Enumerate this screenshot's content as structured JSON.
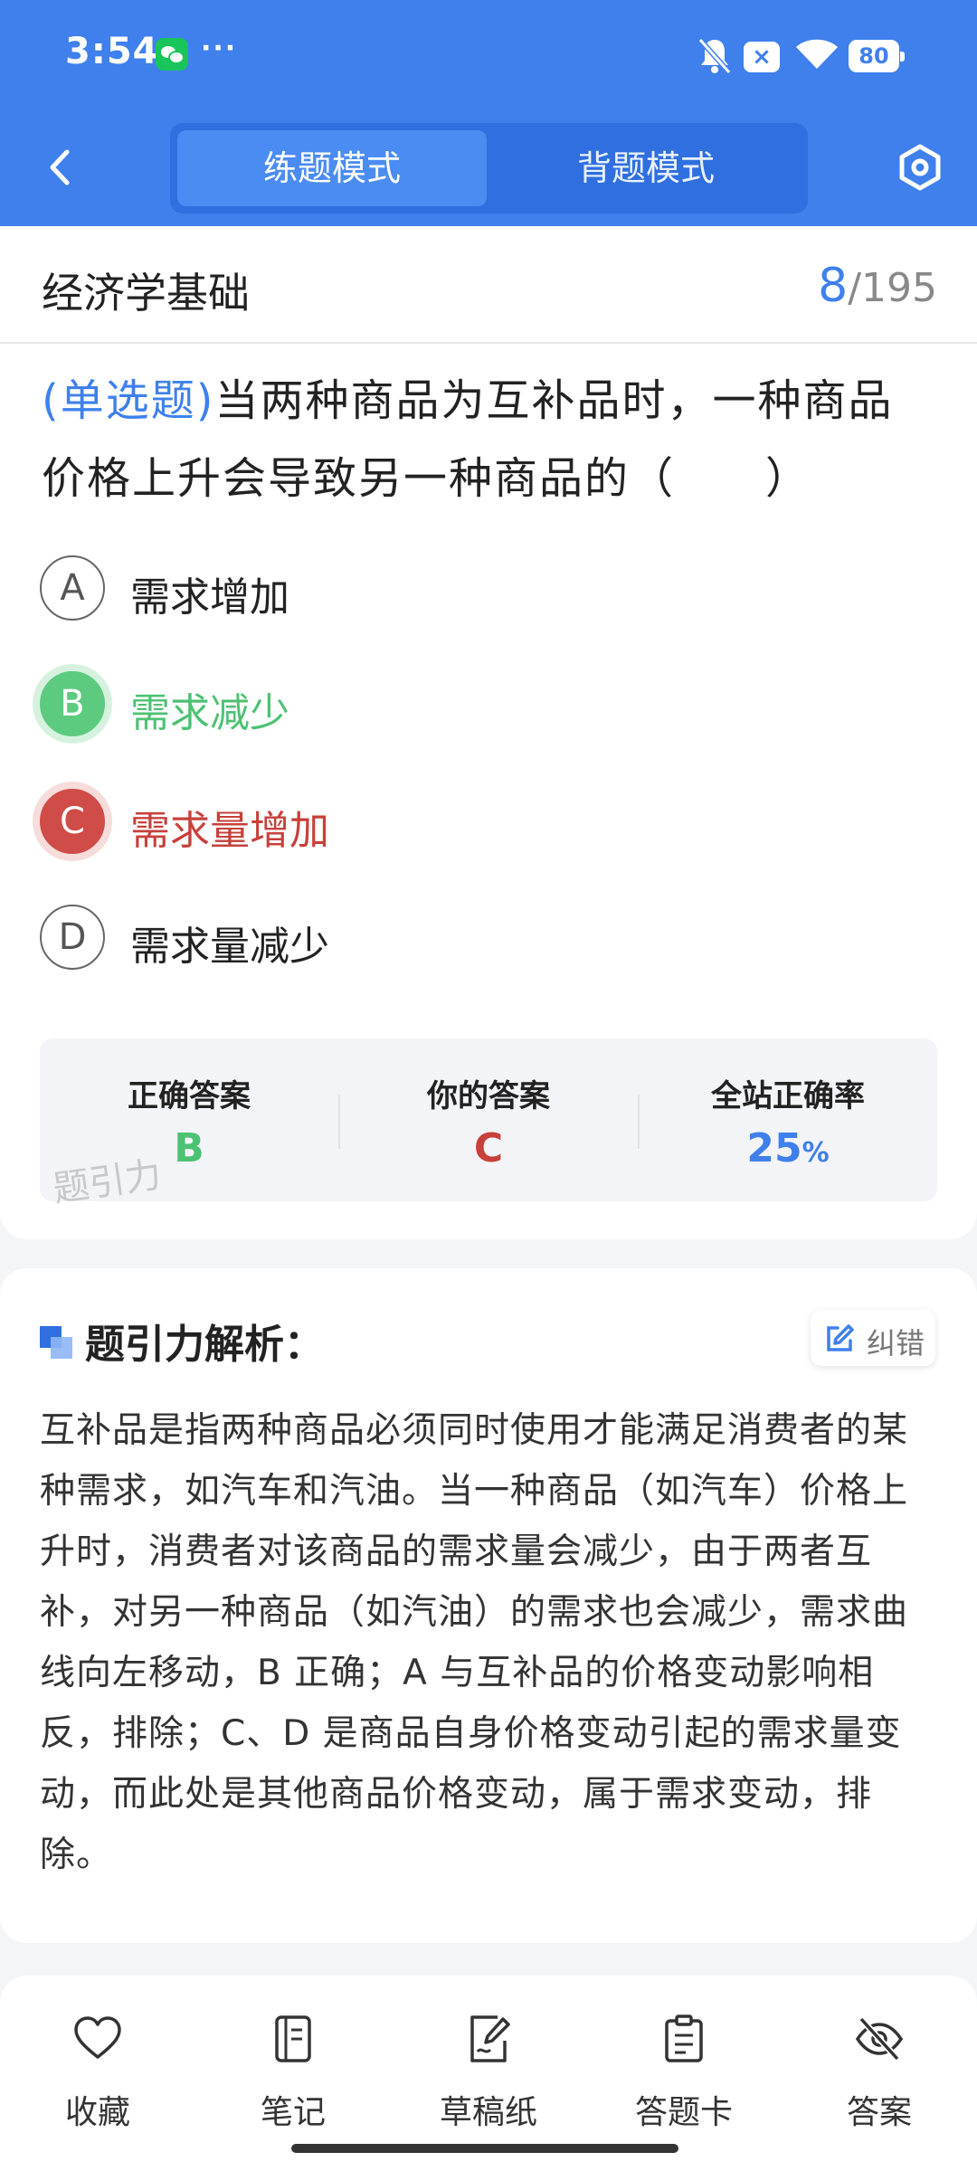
{
  "status_bar": {
    "time": "3:54",
    "dots": "···",
    "x_badge": "×",
    "battery": "80"
  },
  "header": {
    "tabs": [
      {
        "label": "练题模式",
        "active": true
      },
      {
        "label": "背题模式",
        "active": false
      }
    ]
  },
  "question": {
    "subject": "经济学基础",
    "current": "8",
    "total": "/195",
    "type": "(单选题)",
    "text": "当两种商品为互补品时，一种商品价格上升会导致另一种商品的（　　）",
    "options": [
      {
        "letter": "A",
        "label": "需求增加",
        "state": "normal"
      },
      {
        "letter": "B",
        "label": "需求减少",
        "state": "correct"
      },
      {
        "letter": "C",
        "label": "需求量增加",
        "state": "wrong"
      },
      {
        "letter": "D",
        "label": "需求量减少",
        "state": "normal"
      }
    ],
    "answer_summary": {
      "correct_title": "正确答案",
      "correct_value": "B",
      "yours_title": "你的答案",
      "yours_value": "C",
      "rate_title": "全站正确率",
      "rate_value": "25",
      "rate_unit": "%",
      "watermark": "题引力"
    }
  },
  "analysis": {
    "title": "题引力解析：",
    "fix_label": "纠错",
    "text": "互补品是指两种商品必须同时使用才能满足消费者的某种需求，如汽车和汽油。当一种商品（如汽车）价格上升时，消费者对该商品的需求量会减少，由于两者互补，对另一种商品（如汽油）的需求也会减少，需求曲线向左移动，B 正确；A 与互补品的价格变动影响相反，排除；C、D 是商品自身价格变动引起的需求量变动，而此处是其他商品价格变动，属于需求变动，排除。"
  },
  "bottom_nav": [
    {
      "label": "收藏",
      "icon": "heart-icon"
    },
    {
      "label": "笔记",
      "icon": "notebook-icon"
    },
    {
      "label": "草稿纸",
      "icon": "draft-paper-icon"
    },
    {
      "label": "答题卡",
      "icon": "answer-card-icon"
    },
    {
      "label": "答案",
      "icon": "eye-off-icon"
    }
  ],
  "colors": {
    "accent": "#3f80ec",
    "correct": "#4cc272",
    "wrong": "#c8403b"
  }
}
